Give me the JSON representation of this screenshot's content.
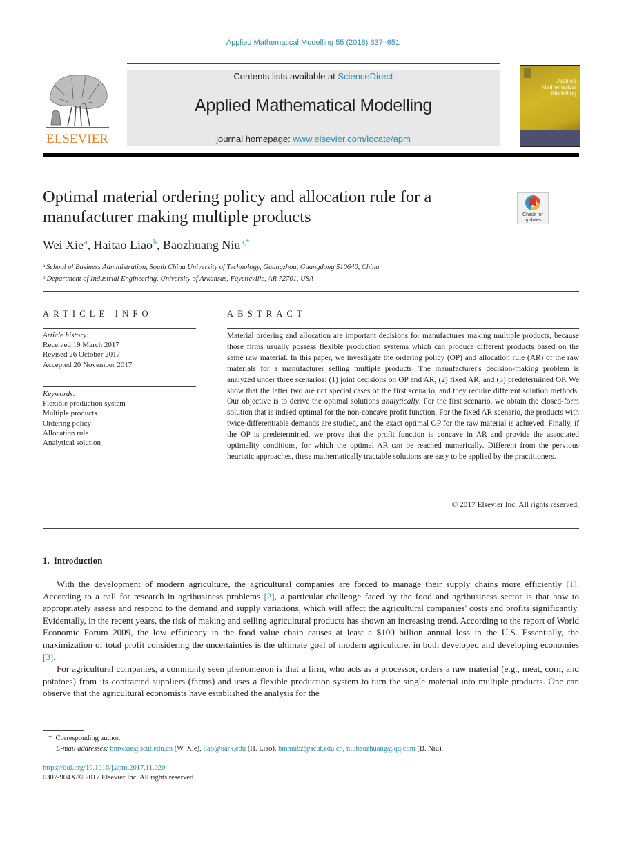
{
  "citation": "Applied Mathematical Modelling 55 (2018) 637–651",
  "header": {
    "publisher_logo_text": "ELSEVIER",
    "contents_prefix": "Contents lists available at ",
    "contents_link": "ScienceDirect",
    "journal_title": "Applied Mathematical Modelling",
    "homepage_prefix": "journal homepage: ",
    "homepage_link": "www.elsevier.com/locate/apm",
    "cover_title_lines": [
      "Applied",
      "Mathematical",
      "Modelling"
    ]
  },
  "crossmark": {
    "line1": "Check for",
    "line2": "updates"
  },
  "article": {
    "title": "Optimal material ordering policy and allocation rule for a manufacturer making multiple products",
    "authors": [
      {
        "name": "Wei Xie",
        "sup": "a"
      },
      {
        "name": "Haitao Liao",
        "sup": "b"
      },
      {
        "name": "Baozhuang Niu",
        "sup": "a,*"
      }
    ],
    "affiliations": [
      {
        "sup": "a",
        "text": "School of Business Administration, South China University of Technology, Guangzhou, Guangdong 510640, China"
      },
      {
        "sup": "b",
        "text": "Department of Industrial Engineering, University of Arkansas, Fayetteville, AR 72701, USA"
      }
    ]
  },
  "article_info": {
    "heading": "ARTICLE INFO",
    "history_label": "Article history:",
    "history": [
      "Received 19 March 2017",
      "Revised 26 October 2017",
      "Accepted 20 November 2017"
    ],
    "keywords_label": "Keywords:",
    "keywords": [
      "Flexible production system",
      "Multiple products",
      "Ordering policy",
      "Allocation rule",
      "Analytical solution"
    ]
  },
  "abstract": {
    "heading": "ABSTRACT",
    "text_before_italic": "Material ordering and allocation are important decisions for manufactures making multiple products, because those firms usually possess flexible production systems which can produce different products based on the same raw material. In this paper, we investigate the ordering policy (OP) and allocation rule (AR) of the raw materials for a manufacturer selling multiple products. The manufacturer's decision-making problem is analyzed under three scenarios: (1) joint decisions on OP and AR, (2) fixed AR, and (3) predetermined OP. We show that the latter two are not special cases of the first scenario, and they require different solution methods. Our objective is to derive the optimal solutions ",
    "italic": "analytically",
    "text_after_italic": ". For the first scenario, we obtain the closed-form solution that is indeed optimal for the non-concave profit function. For the fixed AR scenario, the products with twice-differentiable demands are studied, and the exact optimal OP for the raw material is achieved. Finally, if the OP is predetermined, we prove that the profit function is concave in AR and provide the associated optimality conditions, for which the optimal AR can be reached numerically. Different from the pervious heuristic approaches, these mathematically tractable solutions are easy to be applied by the practitioners.",
    "copyright": "© 2017 Elsevier Inc. All rights reserved."
  },
  "introduction": {
    "number": "1.",
    "heading": "Introduction",
    "p1": {
      "a": "With the development of modern agriculture, the agricultural companies are forced to manage their supply chains more efficiently ",
      "ref1": "[1]",
      "b": ". According to a call for research in agribusiness problems ",
      "ref2": "[2]",
      "c": ", a particular challenge faced by the food and agribusiness sector is that how to appropriately assess and respond to the demand and supply variations, which will affect the agricultural companies' costs and profits significantly. Evidentally, in the recent years, the risk of making and selling agricultural products has shown an increasing trend. According to the report of World Economic Forum 2009, the low efficiency in the food value chain causes at least a $100 billion annual loss in the U.S. Essentially, the maximization of total profit considering the uncertainties is the ultimate goal of modern agriculture, in both developed and developing economies ",
      "ref3": "[3]",
      "d": "."
    },
    "p2": "For agricultural companies, a commonly seen phenomenon is that a firm, who acts as a processor, orders a raw material (e.g., meat, corn, and potatoes) from its contracted suppliers (farms) and uses a flexible production system to turn the single material into multiple products. One can observe that the agricultural economists have established the analysis for the"
  },
  "footnotes": {
    "corresponding_mark": "*",
    "corresponding": "Corresponding author.",
    "email_label": "E-mail addresses:",
    "emails": [
      {
        "addr": "bmwxie@scut.edu.cn",
        "who": " (W. Xie), "
      },
      {
        "addr": "liao@uark.edu",
        "who": " (H. Liao), "
      },
      {
        "addr": "bmniubz@scut.edu.cn",
        "who": ", "
      },
      {
        "addr": "niubaozhuang@qq.com",
        "who": " (B. Niu)."
      }
    ],
    "doi": "https://doi.org/10.1016/j.apm.2017.11.020",
    "issn": "0307-904X/© 2017 Elsevier Inc. All rights reserved."
  },
  "colors": {
    "link": "#2a8bb8",
    "elsevier_orange": "#e87f22",
    "masthead_bg": "#e8e8e8"
  }
}
